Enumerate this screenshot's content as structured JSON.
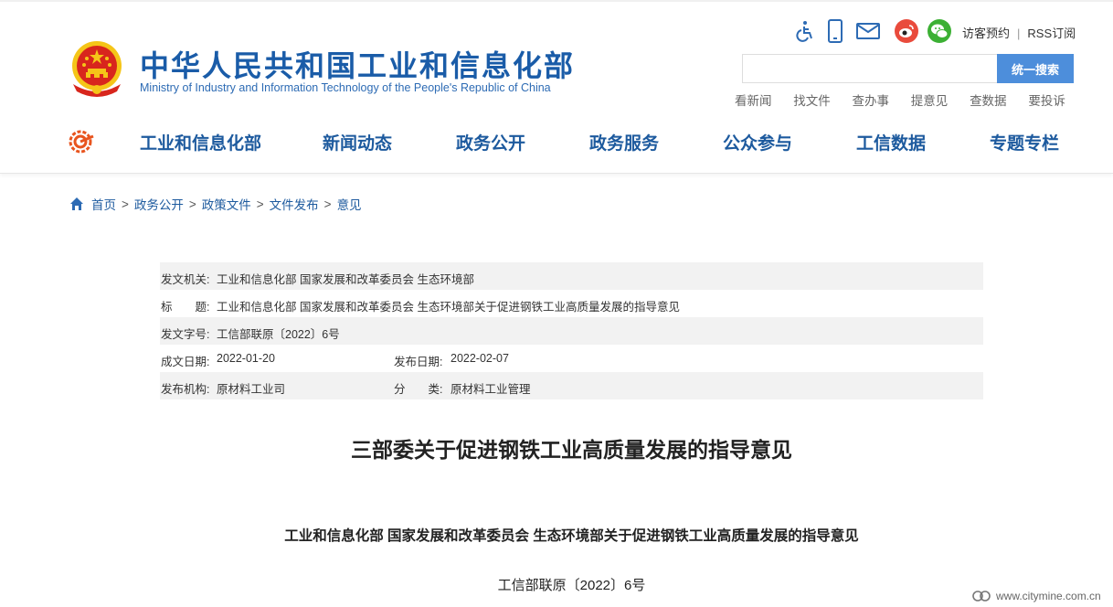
{
  "header": {
    "site_title": "中华人民共和国工业和信息化部",
    "site_subtitle": "Ministry of Industry and Information Technology of the People's Republic of China",
    "tools": {
      "icons": [
        "accessibility-icon",
        "mobile-icon",
        "mail-icon",
        "weibo-icon",
        "wechat-icon"
      ],
      "visitor_booking": "访客预约",
      "separator": "|",
      "rss": "RSS订阅"
    },
    "search": {
      "placeholder": "",
      "button_label": "统一搜索"
    },
    "quick_links": [
      "看新闻",
      "找文件",
      "查办事",
      "提意见",
      "查数据",
      "要投诉"
    ],
    "nav": [
      "工业和信息化部",
      "新闻动态",
      "政务公开",
      "政务服务",
      "公众参与",
      "工信数据",
      "专题专栏"
    ],
    "colors": {
      "brand_blue": "#1a5ca8",
      "search_button": "#4d8edb",
      "emblem_red": "#d8261d",
      "emblem_gold": "#f5c518"
    }
  },
  "breadcrumb": {
    "items": [
      "首页",
      "政务公开",
      "政策文件",
      "文件发布",
      "意见"
    ],
    "separator": ">"
  },
  "meta": {
    "issuer_label": "发文机关:",
    "issuer_value": "工业和信息化部 国家发展和改革委员会 生态环境部",
    "title_label": "标　　题:",
    "title_value": "工业和信息化部 国家发展和改革委员会 生态环境部关于促进钢铁工业高质量发展的指导意见",
    "doc_no_label": "发文字号:",
    "doc_no_value": "工信部联原〔2022〕6号",
    "written_label": "成文日期:",
    "written_value": "2022-01-20",
    "published_label": "发布日期:",
    "published_value": "2022-02-07",
    "org_label": "发布机构:",
    "org_value": "原材料工业司",
    "category_label": "分　　类:",
    "category_value": "原材料工业管理"
  },
  "article": {
    "title": "三部委关于促进钢铁工业高质量发展的指导意见",
    "subheading": "工业和信息化部 国家发展和改革委员会 生态环境部关于促进钢铁工业高质量发展的指导意见",
    "doc_number": "工信部联原〔2022〕6号"
  },
  "watermark": {
    "text": "www.citymine.com.cn"
  }
}
